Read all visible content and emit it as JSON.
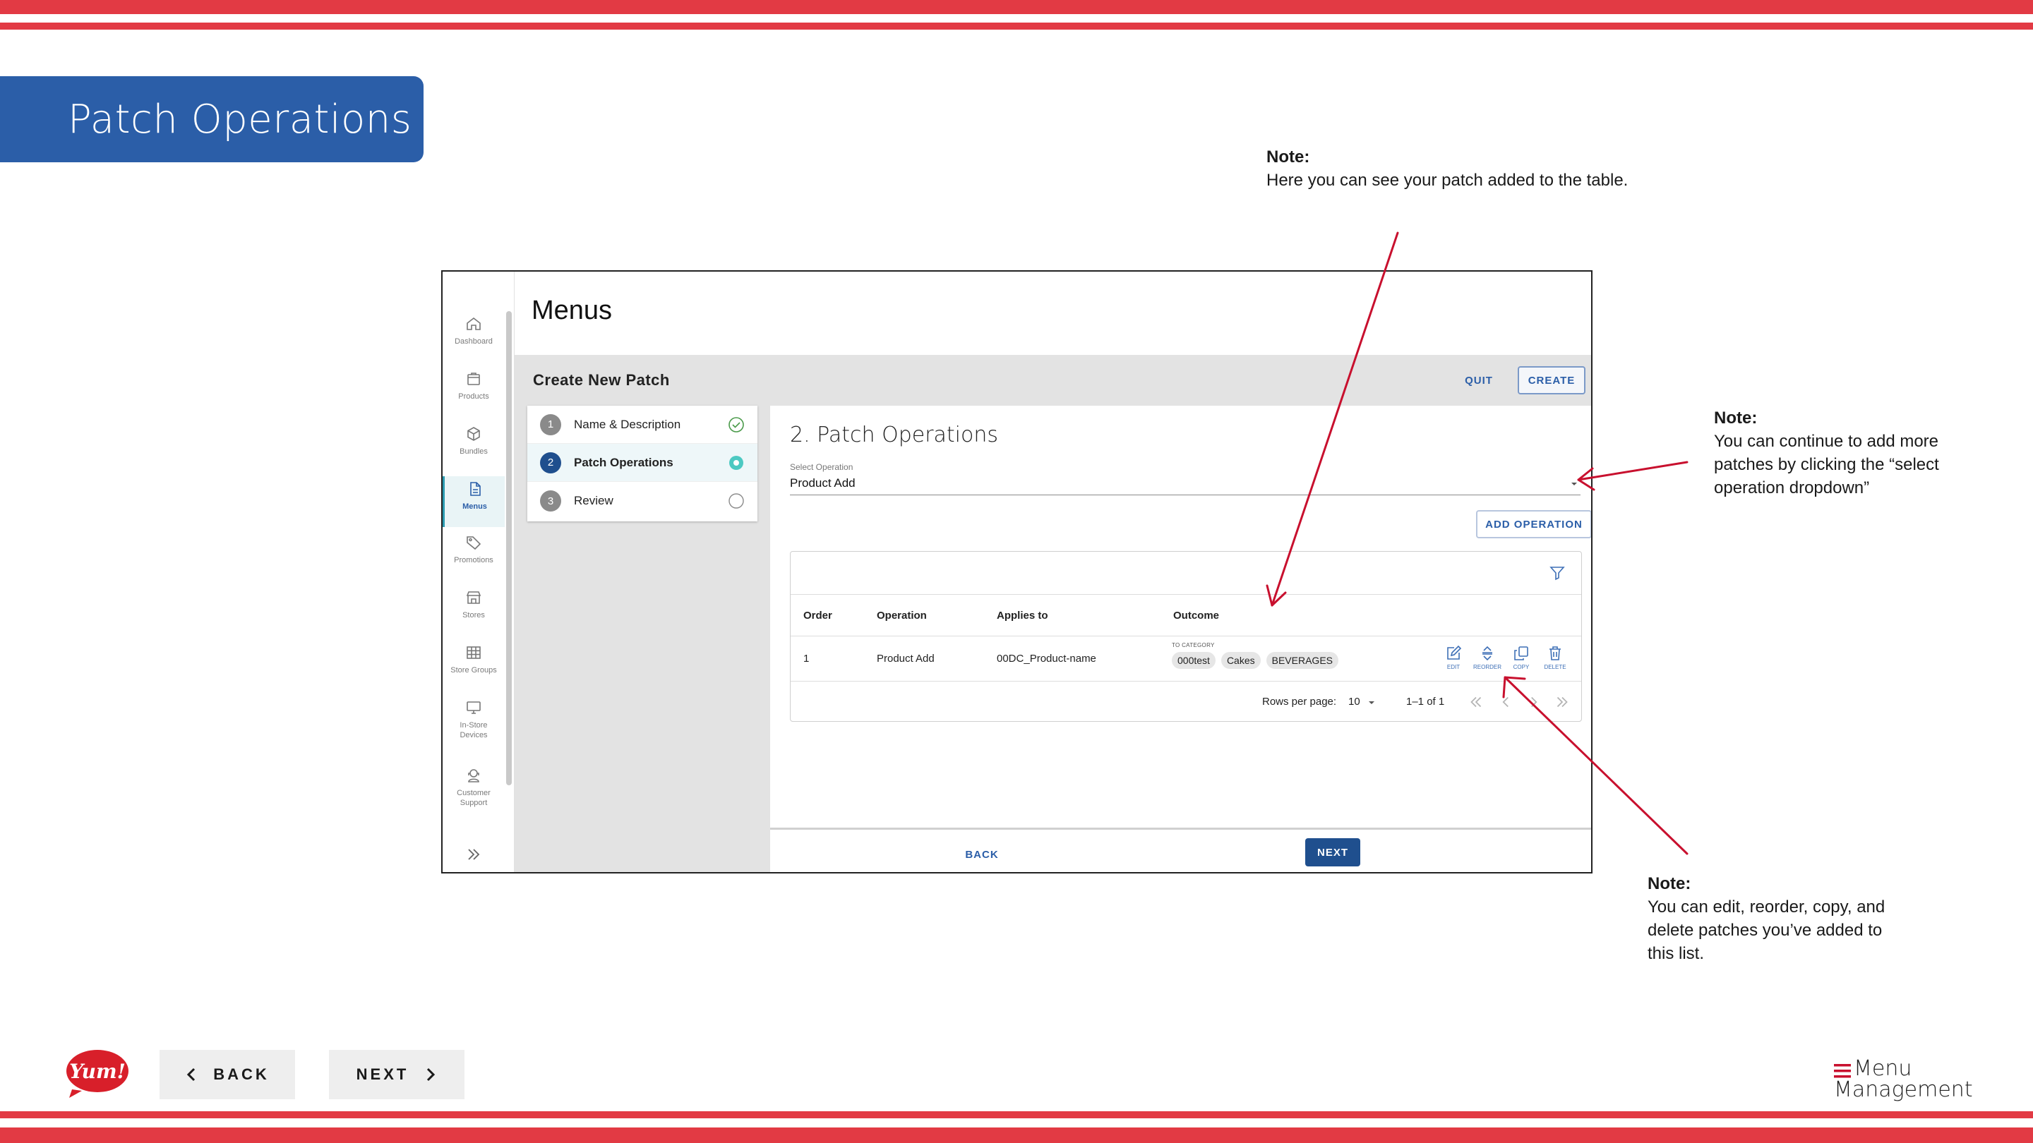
{
  "slide": {
    "title": "Patch Operations",
    "brand_red": "#e23a44",
    "brand_blue": "#2b5ea8",
    "notes": [
      {
        "heading": "Note:",
        "text": "Here you can see your patch added to the table."
      },
      {
        "heading": "Note:",
        "lines": [
          "You can continue to add more",
          "patches by clicking the “select",
          "operation dropdown”"
        ]
      },
      {
        "heading": "Note:",
        "lines": [
          "You can edit, reorder, copy, and",
          "delete patches you’ve added to",
          "this list."
        ]
      }
    ],
    "nav": {
      "back_label": "BACK",
      "next_label": "NEXT"
    },
    "logos": {
      "yum": "Yum!",
      "menu_management_line1": "Menu",
      "menu_management_line2": "Management"
    }
  },
  "app": {
    "sidebar": {
      "items": [
        {
          "label": "Dashboard",
          "icon": "home-icon"
        },
        {
          "label": "Products",
          "icon": "box-icon"
        },
        {
          "label": "Bundles",
          "icon": "cube-icon"
        },
        {
          "label": "Menus",
          "icon": "document-icon",
          "active": true
        },
        {
          "label": "Promotions",
          "icon": "tag-icon"
        },
        {
          "label": "Stores",
          "icon": "store-icon"
        },
        {
          "label": "Store Groups",
          "icon": "grid-icon"
        },
        {
          "label": "In-Store Devices",
          "icon": "monitor-icon"
        },
        {
          "label": "Customer Support",
          "icon": "support-icon"
        }
      ]
    },
    "page_title": "Menus",
    "header": {
      "title": "Create New Patch",
      "quit_label": "QUIT",
      "create_label": "CREATE"
    },
    "stepper": [
      {
        "num": "1",
        "label": "Name & Description",
        "status": "complete"
      },
      {
        "num": "2",
        "label": "Patch Operations",
        "status": "active"
      },
      {
        "num": "3",
        "label": "Review",
        "status": "pending"
      }
    ],
    "content": {
      "title": "2. Patch Operations",
      "select_label": "Select Operation",
      "select_value": "Product Add",
      "add_operation_label": "ADD OPERATION",
      "table": {
        "headers": [
          "Order",
          "Operation",
          "Applies to",
          "Outcome"
        ],
        "rows": [
          {
            "order": "1",
            "operation": "Product Add",
            "applies_to": "00DC_Product-name",
            "outcome_label": "TO CATEGORY",
            "outcome_chips": [
              "000test",
              "Cakes",
              "BEVERAGES"
            ]
          }
        ],
        "actions": [
          "EDIT",
          "REORDER",
          "COPY",
          "DELETE"
        ],
        "pagination": {
          "rows_per_page_label": "Rows per page:",
          "rows_per_page": "10",
          "range": "1–1 of 1"
        }
      },
      "footer": {
        "back_label": "BACK",
        "next_label": "NEXT"
      }
    }
  }
}
